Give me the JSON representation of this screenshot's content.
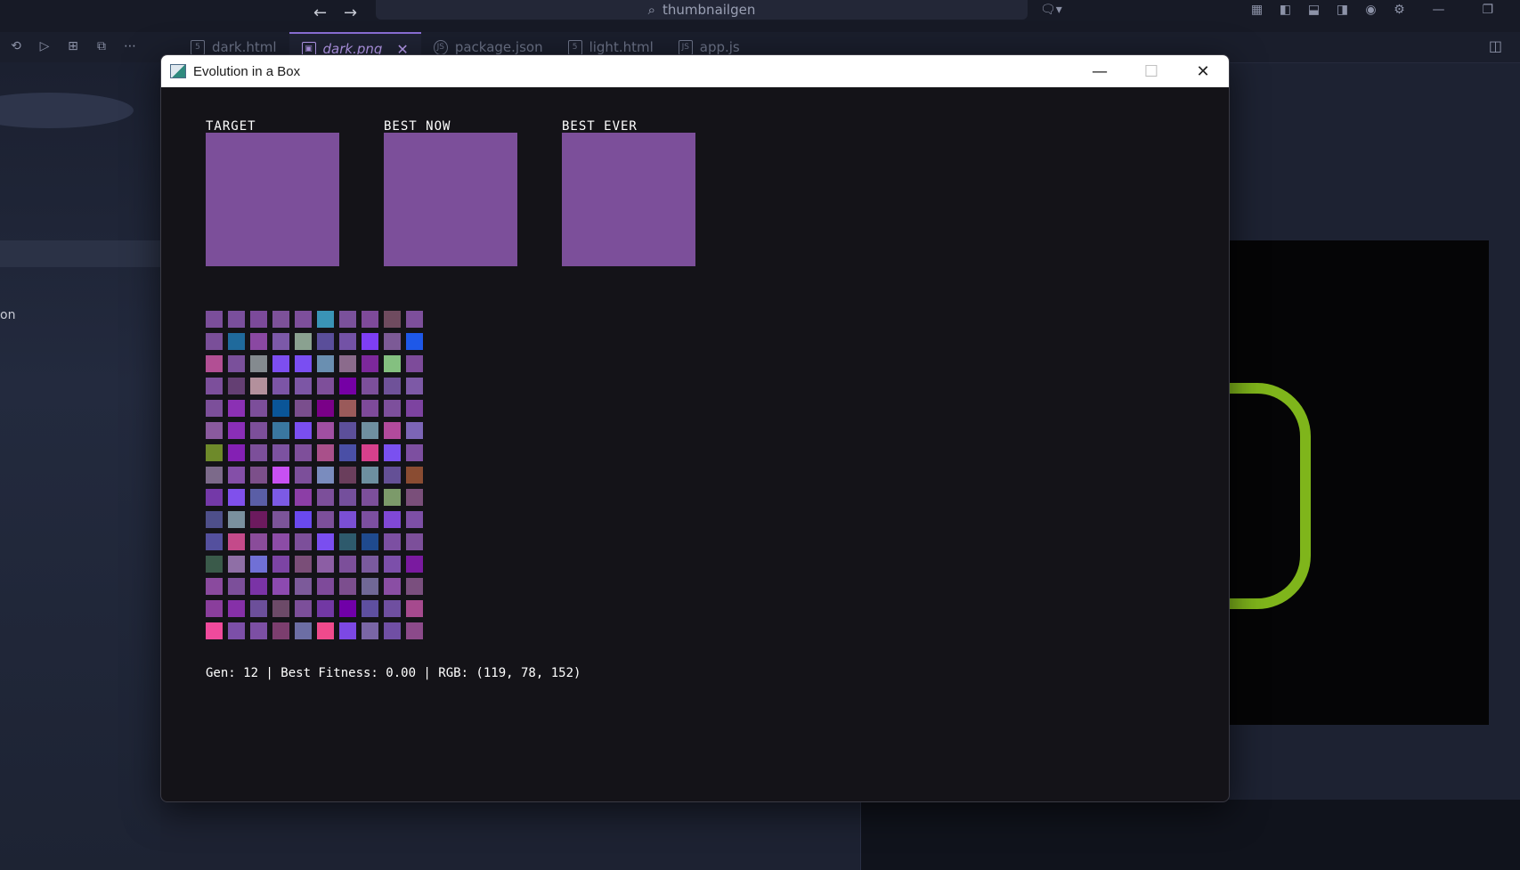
{
  "ide": {
    "search_text": "thumbnailgen",
    "tabs": [
      {
        "label": "dark.html",
        "icon": "5"
      },
      {
        "label": "dark.png",
        "icon": "▣",
        "active": true
      },
      {
        "label": "package.json",
        "icon": "JS"
      },
      {
        "label": "light.html",
        "icon": "5"
      },
      {
        "label": "app.js",
        "icon": "JS"
      }
    ],
    "sidebar_fragment": "on"
  },
  "window": {
    "title": "Evolution in a Box",
    "labels": {
      "target": "TARGET",
      "best_now": "BEST NOW",
      "best_ever": "BEST EVER"
    },
    "colors": {
      "target": "#7c4f9a",
      "best_now": "#7c4f9a",
      "best_ever": "#7c4f9a",
      "background": "#141318"
    },
    "population": [
      "#7b4e9a",
      "#7a4f9c",
      "#7c4a9a",
      "#7d5199",
      "#7d4f9b",
      "#3a94b6",
      "#7a519b",
      "#7e4a9a",
      "#6f4b5f",
      "#7d4f9b",
      "#7a4f99",
      "#1f6a9c",
      "#8a48a2",
      "#7c59a8",
      "#8aa190",
      "#5a4e9a",
      "#7352a6",
      "#7e3ef4",
      "#7c5a96",
      "#1e58e8",
      "#b24f94",
      "#7a509b",
      "#848a8f",
      "#7d4ef0",
      "#7a4ef2",
      "#6a8fb1",
      "#8b6b8c",
      "#7c289a",
      "#84c080",
      "#7d4b9a",
      "#7c4f9b",
      "#643f73",
      "#b3909c",
      "#7c55a6",
      "#7c56a5",
      "#7e4f9a",
      "#7500a5",
      "#7c4f9a",
      "#6f5299",
      "#7d59a6",
      "#7c4f9a",
      "#8b30b4",
      "#7c4e9a",
      "#0a5598",
      "#7a4e8d",
      "#7a0088",
      "#9a5a5a",
      "#7e4a9a",
      "#7d4f9c",
      "#7d43a0",
      "#8a5a9e",
      "#8a2eb7",
      "#7c4f9a",
      "#3a77a0",
      "#7a4ef0",
      "#a04fa2",
      "#5c4f9a",
      "#6f8fa0",
      "#b24a9c",
      "#7c65b6",
      "#6e8a2a",
      "#8420b4",
      "#7c4f9a",
      "#7c52a0",
      "#7e4f9a",
      "#a9508a",
      "#4a4fa6",
      "#d6408c",
      "#7a50f0",
      "#7d4fa0",
      "#7c6a8a",
      "#844fa8",
      "#7c4f8a",
      "#c750f2",
      "#7c4f9a",
      "#7a8cbe",
      "#6a3e5c",
      "#6d8fa0",
      "#645096",
      "#8a4c32",
      "#7439a8",
      "#8050ec",
      "#5a5ea6",
      "#7c5ae4",
      "#8c3ea6",
      "#7c4f9a",
      "#744f9c",
      "#7c4f9a",
      "#7c9a6a",
      "#7a4f7a",
      "#4e4f8a",
      "#7a909e",
      "#6c1a5e",
      "#7c5499",
      "#6a49ee",
      "#7c4f9a",
      "#7a4fd4",
      "#7c4fa0",
      "#8048d6",
      "#7d4fa6",
      "#54509e",
      "#c44a8a",
      "#8a4c9a",
      "#8c4ca6",
      "#7c4f9a",
      "#7a4ef0",
      "#2e5a6c",
      "#1f4a8e",
      "#7c4fa2",
      "#7c4f9a",
      "#3a5a4a",
      "#8f6fa6",
      "#7070d6",
      "#7c44a4",
      "#7a4e78",
      "#8c5ea4",
      "#7c4f9a",
      "#7a5a9e",
      "#7c4faa",
      "#7a1aa0",
      "#8a4a9e",
      "#7c4f9a",
      "#7a33a6",
      "#8c4ab0",
      "#7c5a9a",
      "#7e4a9a",
      "#7c4e8e",
      "#706896",
      "#8a4ea4",
      "#7a4f7e",
      "#8a3e9c",
      "#8630a8",
      "#6c4f9a",
      "#6c4a68",
      "#7c4f9a",
      "#7238a4",
      "#7000a8",
      "#5e4fa0",
      "#6f4fa0",
      "#a64a8e",
      "#f04a9c",
      "#7c4fa8",
      "#7c4fa4",
      "#7c3e6e",
      "#6c6ea4",
      "#f04a8c",
      "#7c48e4",
      "#7a66a6",
      "#704fa4",
      "#8c4a8a"
    ],
    "status": "Gen: 12 | Best Fitness: 0.00 | RGB: (119, 78, 152)"
  }
}
